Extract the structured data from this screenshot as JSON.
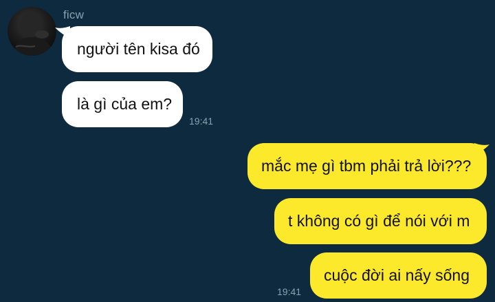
{
  "contact": {
    "name": "ficw"
  },
  "messages": [
    {
      "direction": "incoming",
      "text": "người tên kisa đó"
    },
    {
      "direction": "incoming",
      "text": "là gì của em?",
      "time": "19:41"
    },
    {
      "direction": "outgoing",
      "text": "mắc mẹ gì tbm phải trả lời???"
    },
    {
      "direction": "outgoing",
      "text": "t không có gì để nói với m"
    },
    {
      "direction": "outgoing",
      "text": "cuộc đời ai nấy sống",
      "time": "19:41"
    }
  ],
  "colors": {
    "background": "#0d2a3e",
    "incoming_bubble": "#ffffff",
    "outgoing_bubble": "#fde92b",
    "meta_text": "#8aa0b3"
  }
}
